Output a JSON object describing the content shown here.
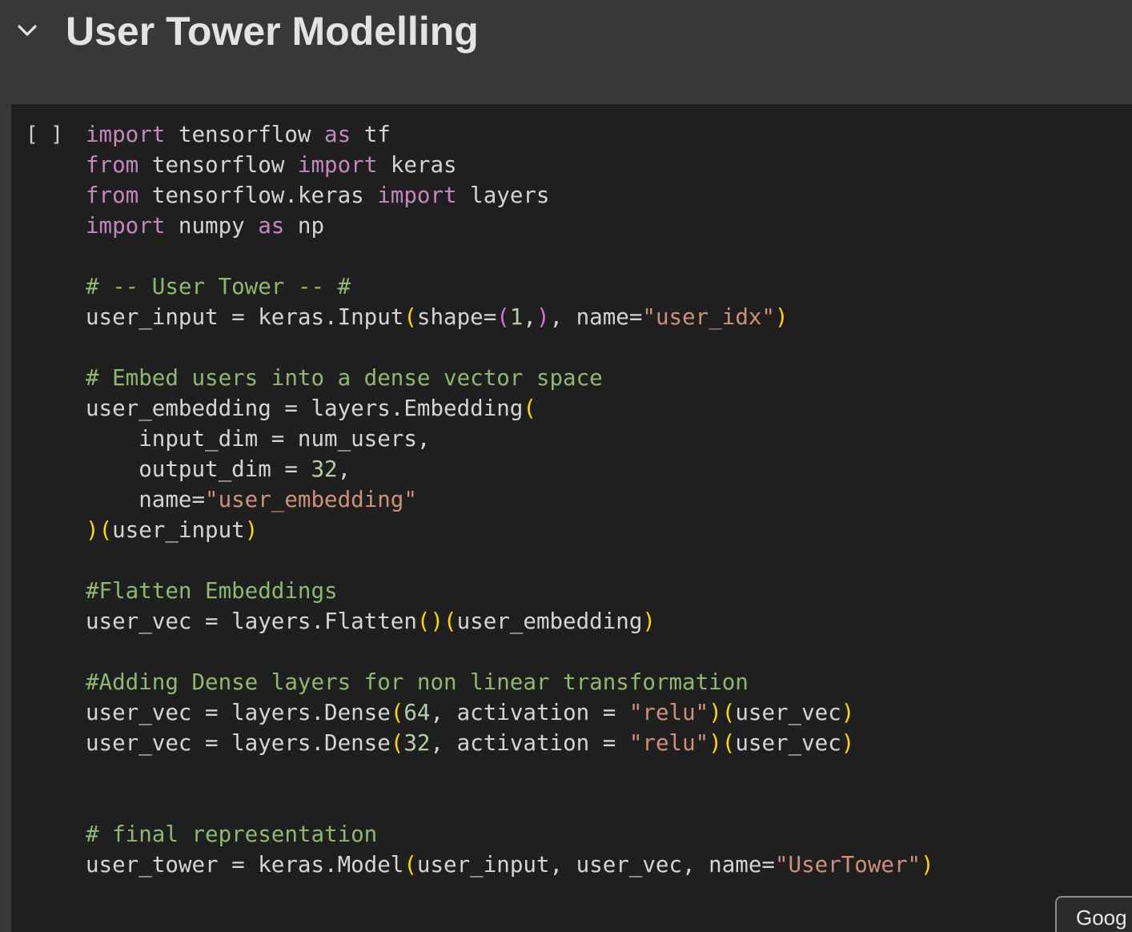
{
  "section": {
    "title": "User Tower Modelling",
    "collapse_icon": "chevron-down-icon"
  },
  "cell": {
    "run_indicator": "[ ]",
    "code_lines": [
      [
        {
          "t": "import",
          "k": "kw"
        },
        {
          "t": " tensorflow ",
          "k": "tx"
        },
        {
          "t": "as",
          "k": "kw"
        },
        {
          "t": " tf",
          "k": "tx"
        }
      ],
      [
        {
          "t": "from",
          "k": "kw"
        },
        {
          "t": " tensorflow ",
          "k": "tx"
        },
        {
          "t": "import",
          "k": "kw"
        },
        {
          "t": " keras",
          "k": "tx"
        }
      ],
      [
        {
          "t": "from",
          "k": "kw"
        },
        {
          "t": " tensorflow.keras ",
          "k": "tx"
        },
        {
          "t": "import",
          "k": "kw"
        },
        {
          "t": " layers",
          "k": "tx"
        }
      ],
      [
        {
          "t": "import",
          "k": "kw"
        },
        {
          "t": " numpy ",
          "k": "tx"
        },
        {
          "t": "as",
          "k": "kw"
        },
        {
          "t": " np",
          "k": "tx"
        }
      ],
      [],
      [
        {
          "t": "# -- User Tower -- #",
          "k": "cm"
        }
      ],
      [
        {
          "t": "user_input = keras.Input",
          "k": "tx"
        },
        {
          "t": "(",
          "k": "p1"
        },
        {
          "t": "shape=",
          "k": "tx"
        },
        {
          "t": "(",
          "k": "p2"
        },
        {
          "t": "1",
          "k": "nm"
        },
        {
          "t": ",",
          "k": "tx"
        },
        {
          "t": ")",
          "k": "p2"
        },
        {
          "t": ", name=",
          "k": "tx"
        },
        {
          "t": "\"user_idx\"",
          "k": "st"
        },
        {
          "t": ")",
          "k": "p1"
        }
      ],
      [],
      [
        {
          "t": "# Embed users into a dense vector space",
          "k": "cm"
        }
      ],
      [
        {
          "t": "user_embedding = layers.Embedding",
          "k": "tx"
        },
        {
          "t": "(",
          "k": "p1"
        }
      ],
      [
        {
          "t": "    input_dim = num_users,",
          "k": "tx"
        }
      ],
      [
        {
          "t": "    output_dim = ",
          "k": "tx"
        },
        {
          "t": "32",
          "k": "nm"
        },
        {
          "t": ",",
          "k": "tx"
        }
      ],
      [
        {
          "t": "    name=",
          "k": "tx"
        },
        {
          "t": "\"user_embedding\"",
          "k": "st"
        }
      ],
      [
        {
          "t": ")",
          "k": "p1"
        },
        {
          "t": "(",
          "k": "p1"
        },
        {
          "t": "user_input",
          "k": "tx"
        },
        {
          "t": ")",
          "k": "p1"
        }
      ],
      [],
      [
        {
          "t": "#Flatten Embeddings",
          "k": "cm"
        }
      ],
      [
        {
          "t": "user_vec = layers.Flatten",
          "k": "tx"
        },
        {
          "t": "()",
          "k": "p1"
        },
        {
          "t": "(",
          "k": "p1"
        },
        {
          "t": "user_embedding",
          "k": "tx"
        },
        {
          "t": ")",
          "k": "p1"
        }
      ],
      [],
      [
        {
          "t": "#Adding Dense layers for non linear transformation",
          "k": "cm"
        }
      ],
      [
        {
          "t": "user_vec = layers.Dense",
          "k": "tx"
        },
        {
          "t": "(",
          "k": "p1"
        },
        {
          "t": "64",
          "k": "nm"
        },
        {
          "t": ", activation = ",
          "k": "tx"
        },
        {
          "t": "\"relu\"",
          "k": "st"
        },
        {
          "t": ")",
          "k": "p1"
        },
        {
          "t": "(",
          "k": "p1"
        },
        {
          "t": "user_vec",
          "k": "tx"
        },
        {
          "t": ")",
          "k": "p1"
        }
      ],
      [
        {
          "t": "user_vec = layers.Dense",
          "k": "tx"
        },
        {
          "t": "(",
          "k": "p1"
        },
        {
          "t": "32",
          "k": "nm"
        },
        {
          "t": ", activation = ",
          "k": "tx"
        },
        {
          "t": "\"relu\"",
          "k": "st"
        },
        {
          "t": ")",
          "k": "p1"
        },
        {
          "t": "(",
          "k": "p1"
        },
        {
          "t": "user_vec",
          "k": "tx"
        },
        {
          "t": ")",
          "k": "p1"
        }
      ],
      [],
      [],
      [
        {
          "t": "# final representation",
          "k": "cm"
        }
      ],
      [
        {
          "t": "user_tower = keras.Model",
          "k": "tx"
        },
        {
          "t": "(",
          "k": "p1"
        },
        {
          "t": "user_input, user_vec, name=",
          "k": "tx"
        },
        {
          "t": "\"UserTower\"",
          "k": "st"
        },
        {
          "t": ")",
          "k": "p1"
        }
      ]
    ]
  },
  "tooltip": {
    "label": "Goog"
  },
  "colors": {
    "keyword": "#c586c0",
    "comment": "#8fb86f",
    "string": "#ce9178",
    "number": "#b5cea8",
    "bracket_level1": "#ffd700",
    "bracket_level2": "#da70d6",
    "text": "#d4d4d4",
    "cell_background": "#1f1f1f",
    "page_background": "#383838"
  }
}
